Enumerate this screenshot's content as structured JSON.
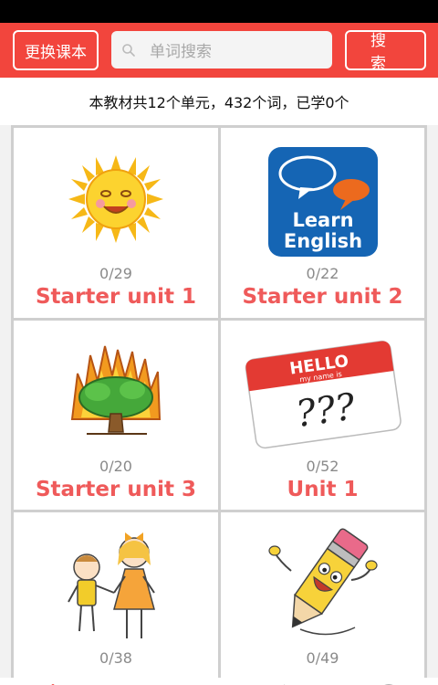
{
  "header": {
    "change_book_label": "更换课本",
    "search_placeholder": "单词搜索",
    "search_button_label": "搜 索"
  },
  "summary": {
    "text": "本教材共12个单元，432个词，已学0个"
  },
  "units": [
    {
      "name": "Starter unit 1",
      "progress": "0/29",
      "icon": "sun-icon"
    },
    {
      "name": "Starter unit 2",
      "progress": "0/22",
      "icon": "learn-english-icon",
      "icon_text_1": "Learn",
      "icon_text_2": "English"
    },
    {
      "name": "Starter unit 3",
      "progress": "0/20",
      "icon": "burning-tree-icon"
    },
    {
      "name": "Unit 1",
      "progress": "0/52",
      "icon": "hello-name-tag-icon",
      "icon_text_1": "HELLO",
      "icon_text_2": "my name is",
      "icon_text_3": "???"
    },
    {
      "name": "",
      "progress": "0/38",
      "icon": "kids-holding-hands-icon"
    },
    {
      "name": "",
      "progress": "0/49",
      "icon": "pencil-character-icon"
    }
  ],
  "colors": {
    "accent": "#f2453d",
    "unit_title": "#ef5a5a",
    "count": "#8a8a8a"
  }
}
